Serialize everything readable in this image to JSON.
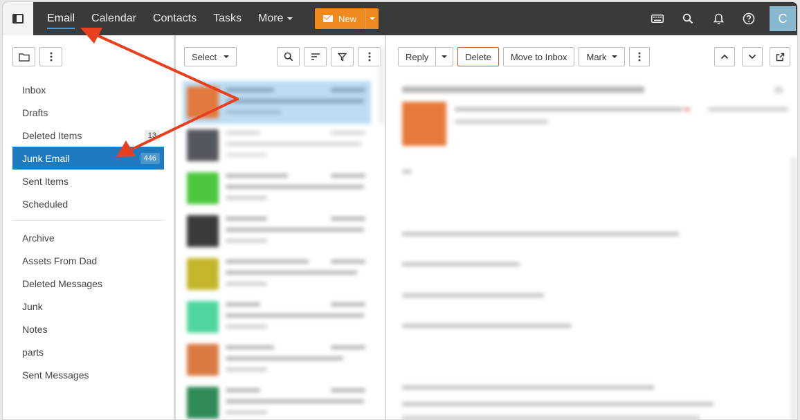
{
  "topbar": {
    "nav": [
      {
        "label": "Email",
        "active": true
      },
      {
        "label": "Calendar",
        "active": false
      },
      {
        "label": "Contacts",
        "active": false
      },
      {
        "label": "Tasks",
        "active": false
      },
      {
        "label": "More",
        "active": false
      }
    ],
    "new_label": "New",
    "new_color": "#ef8a1f",
    "icons": [
      "keyboard-icon",
      "search-icon",
      "bell-icon",
      "help-icon"
    ],
    "avatar_letter": "C",
    "avatar_color": "#88b7d0"
  },
  "folders": {
    "primary": [
      {
        "label": "Inbox",
        "count": ""
      },
      {
        "label": "Drafts",
        "count": ""
      },
      {
        "label": "Deleted Items",
        "count": "13"
      },
      {
        "label": "Junk Email",
        "count": "446",
        "selected": true
      },
      {
        "label": "Sent Items",
        "count": ""
      },
      {
        "label": "Scheduled",
        "count": ""
      }
    ],
    "secondary": [
      {
        "label": "Archive"
      },
      {
        "label": "Assets From Dad"
      },
      {
        "label": "Deleted Messages"
      },
      {
        "label": "Junk"
      },
      {
        "label": "Notes"
      },
      {
        "label": "parts"
      },
      {
        "label": "Sent Messages"
      }
    ],
    "selected_color": "#1f7bbf"
  },
  "list": {
    "select_label": "Select",
    "avatar_colors": [
      "#e27a3f",
      "#55575e",
      "#4cc63f",
      "#3a3a3a",
      "#c4b52a",
      "#4fd6a0",
      "#d97a42",
      "#2f8a57"
    ]
  },
  "reader": {
    "reply_label": "Reply",
    "delete_label": "Delete",
    "move_label": "Move to Inbox",
    "mark_label": "Mark",
    "sender_avatar_color": "#e57a3c"
  },
  "annotation": {
    "arrow_color": "#e8401f"
  }
}
